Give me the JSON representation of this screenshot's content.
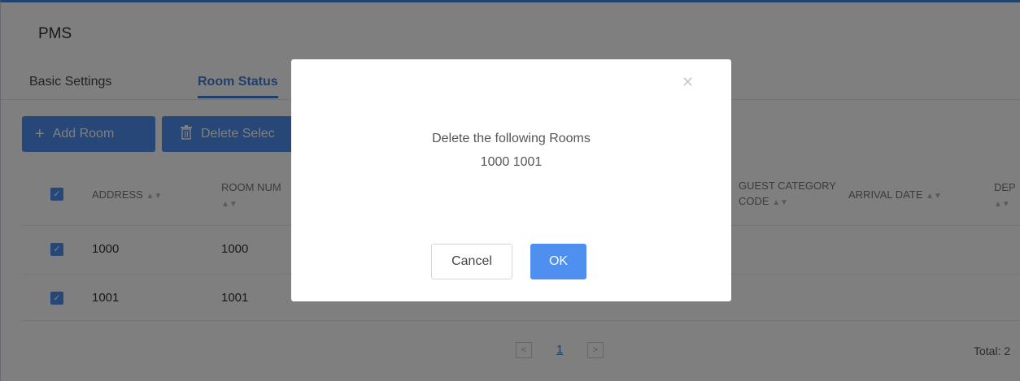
{
  "page": {
    "title": "PMS"
  },
  "tabs": [
    {
      "label": "Basic Settings"
    },
    {
      "label": "Room Status"
    }
  ],
  "toolbar": {
    "add_label": "Add Room",
    "add_icon": "plus-icon",
    "delete_label": "Delete Selec",
    "delete_icon": "trash-icon"
  },
  "table": {
    "columns": {
      "address": "ADDRESS",
      "room_num": "ROOM NUM",
      "guest_category_line1": "GUEST CATEGORY",
      "guest_category_line2": "CODE",
      "arrival_date": "ARRIVAL DATE",
      "dep": "DEP"
    },
    "rows": [
      {
        "address": "1000",
        "room_num": "1000"
      },
      {
        "address": "1001",
        "room_num": "1001"
      }
    ]
  },
  "pagination": {
    "current": "1",
    "total": "Total: 2"
  },
  "dialog": {
    "message": "Delete the following Rooms",
    "rooms": "1000 1001",
    "cancel_label": "Cancel",
    "ok_label": "OK"
  },
  "colors": {
    "accent": "#4e8ff0",
    "tab_active": "#3f7fd6"
  }
}
